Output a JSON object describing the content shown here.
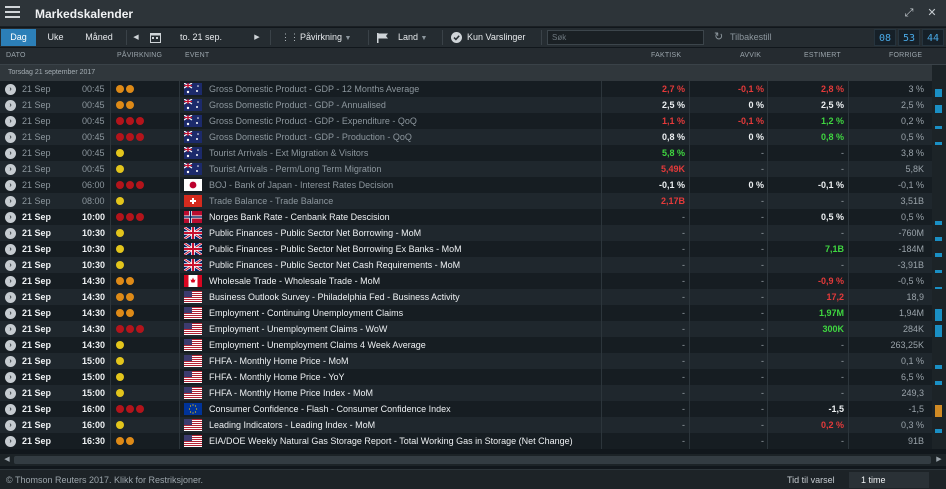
{
  "app": {
    "title": "Markedskalender"
  },
  "toolbar": {
    "period_tabs": [
      "Dag",
      "Uke",
      "Måned"
    ],
    "active_period": "Dag",
    "date": "to. 21 sep.",
    "impact_filter": "Påvirkning",
    "country_filter": "Land",
    "alerts_only": "Kun Varslinger",
    "search_placeholder": "Søk",
    "reset": "Tilbakestill",
    "clock": {
      "h": "08",
      "m": "53",
      "s": "44"
    }
  },
  "columns": {
    "date": "DATO",
    "impact": "PÅVIRKNING",
    "event": "EVENT",
    "actual": "FAKTISK",
    "deviation": "AVVIK",
    "estimate": "ESTIMERT",
    "previous": "FORRIGE"
  },
  "group": {
    "label": "Torsdag 21 september 2017"
  },
  "colors": {
    "high": "#b3141b",
    "medium": "#de8a17",
    "low": "#e3c51c",
    "positive": "#3fd640",
    "negative": "#e53a3a",
    "accent": "#2c7fb8"
  },
  "rows": [
    {
      "date": "21 Sep",
      "time": "00:45",
      "impact": 2,
      "flag": "au",
      "event": "Gross Domestic Product - GDP - 12 Months Average",
      "actual": "2,7 %",
      "actual_c": "red",
      "dev": "-0,1 %",
      "dev_c": "red",
      "est": "2,8 %",
      "est_c": "red",
      "prev": "3 %",
      "past": true,
      "bar": 0.55
    },
    {
      "date": "21 Sep",
      "time": "00:45",
      "impact": 2,
      "flag": "au",
      "event": "Gross Domestic Product - GDP - Annualised",
      "actual": "2,5 %",
      "actual_c": "white",
      "dev": "0 %",
      "dev_c": "white",
      "est": "2,5 %",
      "est_c": "white",
      "prev": "2,5 %",
      "past": true,
      "bar": 0.55
    },
    {
      "date": "21 Sep",
      "time": "00:45",
      "impact": 3,
      "flag": "au",
      "event": "Gross Domestic Product - GDP - Expenditure - QoQ",
      "actual": "1,1 %",
      "actual_c": "red",
      "dev": "-0,1 %",
      "dev_c": "red",
      "est": "1,2 %",
      "est_c": "green",
      "prev": "0,2 %",
      "past": true,
      "bar": 0.2
    },
    {
      "date": "21 Sep",
      "time": "00:45",
      "impact": 3,
      "flag": "au",
      "event": "Gross Domestic Product - GDP - Production - QoQ",
      "actual": "0,8 %",
      "actual_c": "white",
      "dev": "0 %",
      "dev_c": "white",
      "est": "0,8 %",
      "est_c": "green",
      "prev": "0,5 %",
      "past": true,
      "bar": 0.2
    },
    {
      "date": "21 Sep",
      "time": "00:45",
      "impact": 1,
      "flag": "au",
      "event": "Tourist Arrivals - Ext Migration & Visitors",
      "actual": "5,8 %",
      "actual_c": "green",
      "dev": "-",
      "dev_c": "gray",
      "est": "-",
      "est_c": "gray",
      "prev": "3,8 %",
      "past": true,
      "bar": 0
    },
    {
      "date": "21 Sep",
      "time": "00:45",
      "impact": 1,
      "flag": "au",
      "event": "Tourist Arrivals - Perm/Long Term Migration",
      "actual": "5,49K",
      "actual_c": "red",
      "dev": "-",
      "dev_c": "gray",
      "est": "-",
      "est_c": "gray",
      "prev": "5,8K",
      "past": true,
      "bar": 0
    },
    {
      "date": "21 Sep",
      "time": "06:00",
      "impact": 3,
      "flag": "jp",
      "event": "BOJ - Bank of Japan - Interest Rates Decision",
      "actual": "-0,1 %",
      "actual_c": "white",
      "dev": "0 %",
      "dev_c": "white",
      "est": "-0,1 %",
      "est_c": "white",
      "prev": "-0,1 %",
      "past": true,
      "bar": 0
    },
    {
      "date": "21 Sep",
      "time": "08:00",
      "impact": 1,
      "flag": "ch",
      "event": "Trade Balance - Trade Balance",
      "actual": "2,17B",
      "actual_c": "red",
      "dev": "-",
      "dev_c": "gray",
      "est": "-",
      "est_c": "gray",
      "prev": "3,51B",
      "past": true,
      "bar": 0
    },
    {
      "date": "21 Sep",
      "time": "10:00",
      "impact": 3,
      "flag": "no",
      "event": "Norges Bank Rate - Cenbank Rate Descision",
      "actual": "-",
      "actual_c": "gray",
      "dev": "-",
      "dev_c": "gray",
      "est": "0,5 %",
      "est_c": "white",
      "prev": "0,5 %",
      "past": false,
      "bar": 0.3
    },
    {
      "date": "21 Sep",
      "time": "10:30",
      "impact": 1,
      "flag": "uk",
      "event": "Public Finances - Public Sector Net Borrowing - MoM",
      "actual": "-",
      "actual_c": "gray",
      "dev": "-",
      "dev_c": "gray",
      "est": "-",
      "est_c": "gray",
      "prev": "-760M",
      "past": false,
      "bar": 0.3
    },
    {
      "date": "21 Sep",
      "time": "10:30",
      "impact": 1,
      "flag": "uk",
      "event": "Public Finances - Public Sector Net Borrowing Ex Banks - MoM",
      "actual": "-",
      "actual_c": "gray",
      "dev": "-",
      "dev_c": "gray",
      "est": "7,1B",
      "est_c": "green",
      "prev": "-184M",
      "past": false,
      "bar": 0.3
    },
    {
      "date": "21 Sep",
      "time": "10:30",
      "impact": 1,
      "flag": "uk",
      "event": "Public Finances - Public Sector Net Cash Requirements - MoM",
      "actual": "-",
      "actual_c": "gray",
      "dev": "-",
      "dev_c": "gray",
      "est": "-",
      "est_c": "gray",
      "prev": "-3,91B",
      "past": false,
      "bar": 0.2
    },
    {
      "date": "21 Sep",
      "time": "14:30",
      "impact": 2,
      "flag": "ca",
      "event": "Wholesale Trade - Wholesale Trade - MoM",
      "actual": "-",
      "actual_c": "gray",
      "dev": "-",
      "dev_c": "gray",
      "est": "-0,9 %",
      "est_c": "red",
      "prev": "-0,5 %",
      "past": false,
      "bar": 0.1
    },
    {
      "date": "21 Sep",
      "time": "14:30",
      "impact": 2,
      "flag": "us",
      "event": "Business Outlook Survey - Philadelphia Fed - Business Activity",
      "actual": "-",
      "actual_c": "gray",
      "dev": "-",
      "dev_c": "gray",
      "est": "17,2",
      "est_c": "red",
      "prev": "18,9",
      "past": false,
      "bar": 0
    },
    {
      "date": "21 Sep",
      "time": "14:30",
      "impact": 2,
      "flag": "us",
      "event": "Employment - Continuing Unemployment Claims",
      "actual": "-",
      "actual_c": "gray",
      "dev": "-",
      "dev_c": "gray",
      "est": "1,97M",
      "est_c": "green",
      "prev": "1,94M",
      "past": false,
      "bar": 0.85
    },
    {
      "date": "21 Sep",
      "time": "14:30",
      "impact": 3,
      "flag": "us",
      "event": "Employment - Unemployment Claims - WoW",
      "actual": "-",
      "actual_c": "gray",
      "dev": "-",
      "dev_c": "gray",
      "est": "300K",
      "est_c": "green",
      "prev": "284K",
      "past": false,
      "bar": 0.85
    },
    {
      "date": "21 Sep",
      "time": "14:30",
      "impact": 1,
      "flag": "us",
      "event": "Employment - Unemployment Claims 4 Week Average",
      "actual": "-",
      "actual_c": "gray",
      "dev": "-",
      "dev_c": "gray",
      "est": "-",
      "est_c": "gray",
      "prev": "263,25K",
      "past": false,
      "bar": 0
    },
    {
      "date": "21 Sep",
      "time": "15:00",
      "impact": 1,
      "flag": "us",
      "event": "FHFA - Monthly Home Price - MoM",
      "actual": "-",
      "actual_c": "gray",
      "dev": "-",
      "dev_c": "gray",
      "est": "-",
      "est_c": "gray",
      "prev": "0,1 %",
      "past": false,
      "bar": 0.3
    },
    {
      "date": "21 Sep",
      "time": "15:00",
      "impact": 1,
      "flag": "us",
      "event": "FHFA - Monthly Home Price - YoY",
      "actual": "-",
      "actual_c": "gray",
      "dev": "-",
      "dev_c": "gray",
      "est": "-",
      "est_c": "gray",
      "prev": "6,5 %",
      "past": false,
      "bar": 0.3
    },
    {
      "date": "21 Sep",
      "time": "15:00",
      "impact": 1,
      "flag": "us",
      "event": "FHFA - Monthly Home Price Index - MoM",
      "actual": "-",
      "actual_c": "gray",
      "dev": "-",
      "dev_c": "gray",
      "est": "-",
      "est_c": "gray",
      "prev": "249,3",
      "past": false,
      "bar": 0
    },
    {
      "date": "21 Sep",
      "time": "16:00",
      "impact": 3,
      "flag": "eu",
      "event": "Consumer Confidence - Flash - Consumer Confidence Index",
      "actual": "-",
      "actual_c": "gray",
      "dev": "-",
      "dev_c": "gray",
      "est": "-1,5",
      "est_c": "white",
      "prev": "-1,5",
      "past": false,
      "bar": 0.85,
      "bar_c": "#d08a24"
    },
    {
      "date": "21 Sep",
      "time": "16:00",
      "impact": 1,
      "flag": "us",
      "event": "Leading Indicators - Leading Index - MoM",
      "actual": "-",
      "actual_c": "gray",
      "dev": "-",
      "dev_c": "gray",
      "est": "0,2 %",
      "est_c": "red",
      "prev": "0,3 %",
      "past": false,
      "bar": 0.3
    },
    {
      "date": "21 Sep",
      "time": "16:30",
      "impact": 2,
      "flag": "us",
      "event": "EIA/DOE Weekly Natural Gas Storage Report - Total Working Gas in Storage (Net Change)",
      "actual": "-",
      "actual_c": "gray",
      "dev": "-",
      "dev_c": "gray",
      "est": "-",
      "est_c": "gray",
      "prev": "91B",
      "past": false,
      "bar": 0
    }
  ],
  "footer": {
    "copyright": "© Thomson Reuters 2017. Klikk for Restriksjoner.",
    "time_to_alert_label": "Tid til varsel",
    "time_to_alert_value": "1 time"
  }
}
